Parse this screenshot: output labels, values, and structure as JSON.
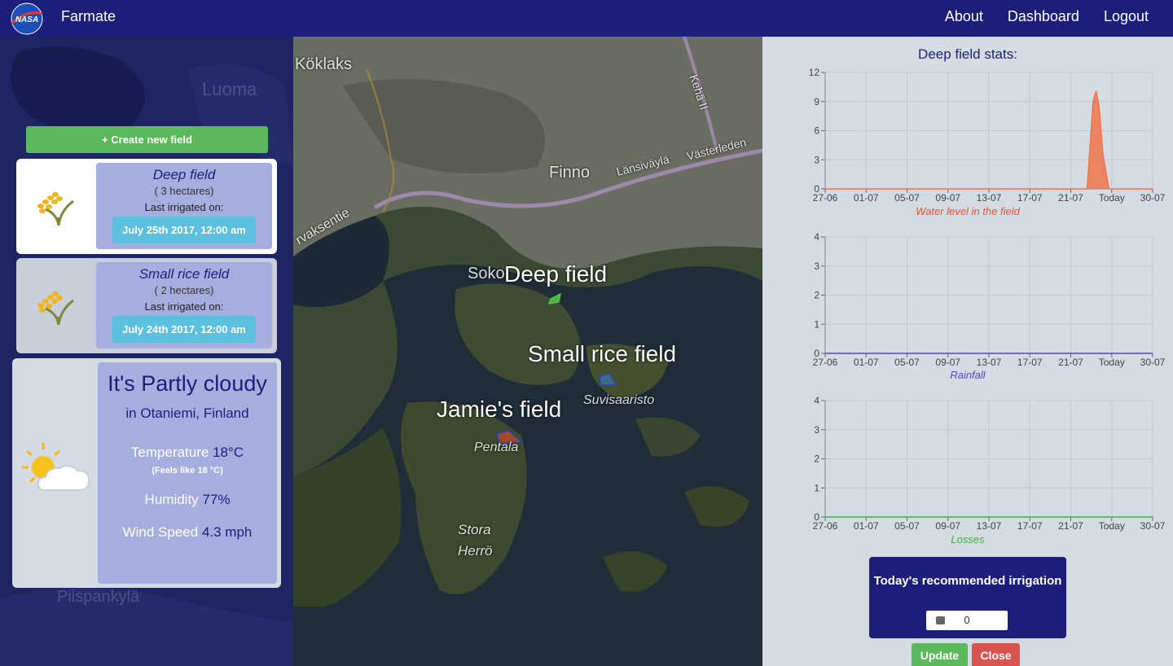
{
  "nav": {
    "logo_text": "NASA",
    "brand": "Farmate",
    "links": [
      "About",
      "Dashboard",
      "Logout"
    ]
  },
  "left": {
    "background_places": [
      "Luoma",
      "Piispankylä"
    ],
    "create_button": "+ Create new field",
    "fields": [
      {
        "name": "Deep field",
        "size": "( 3 hectares)",
        "last_label": "Last irrigated on:",
        "date": "July 25th 2017, 12:00 am",
        "icon": "rice-plant-icon"
      },
      {
        "name": "Small rice field",
        "size": "( 2 hectares)",
        "last_label": "Last irrigated on:",
        "date": "July 24th 2017, 12:00 am",
        "icon": "rice-plant-icon"
      }
    ],
    "weather": {
      "icon": "partly-cloudy-icon",
      "title": "It's Partly cloudy",
      "location": "in Otaniemi, Finland",
      "temp_label": "Temperature",
      "temp_value": "18°C",
      "feels": "(Feels like 18 °C)",
      "humidity_label": "Humidity",
      "humidity_value": "77%",
      "wind_label": "Wind Speed",
      "wind_value": "4.3 mph"
    }
  },
  "map": {
    "places": [
      "Köklaks",
      "Kehä II",
      "Finno",
      "Länsiväylä",
      "Västerleden",
      "rvaksentie",
      "Soko",
      "Suvisaaristo",
      "Pentala",
      "Stora",
      "Herrö"
    ],
    "fields": [
      "Deep field",
      "Small rice field",
      "Jamie's field"
    ]
  },
  "stats": {
    "title": "Deep field stats:",
    "colors": {
      "water": "#f0734a",
      "rainfall": "#5b44c6",
      "losses": "#3cb43c",
      "axis": "#333333"
    }
  },
  "chart_data": [
    {
      "type": "area",
      "caption": "Water level in the field",
      "x_ticks": [
        "27-06",
        "01-07",
        "05-07",
        "09-07",
        "13-07",
        "17-07",
        "21-07",
        "Today",
        "30-07"
      ],
      "y_ticks": [
        0,
        3,
        6,
        9,
        12
      ],
      "ylim": [
        0,
        12
      ],
      "x_range": [
        0,
        33
      ],
      "series": [
        {
          "x": [
            0,
            25,
            26.4,
            26.7,
            27.0,
            27.3,
            27.6,
            28.0,
            28.6,
            33
          ],
          "y": [
            0,
            0,
            0,
            4.5,
            9.0,
            10.1,
            8.5,
            3.5,
            0,
            0
          ]
        }
      ]
    },
    {
      "type": "line",
      "caption": "Rainfall",
      "x_ticks": [
        "27-06",
        "01-07",
        "05-07",
        "09-07",
        "13-07",
        "17-07",
        "21-07",
        "Today",
        "30-07"
      ],
      "y_ticks": [
        0,
        1,
        2,
        3,
        4
      ],
      "ylim": [
        0,
        4
      ],
      "x_range": [
        0,
        33
      ],
      "series": [
        {
          "x": [
            0,
            33
          ],
          "y": [
            0,
            0
          ]
        }
      ]
    },
    {
      "type": "line",
      "caption": "Losses",
      "x_ticks": [
        "27-06",
        "01-07",
        "05-07",
        "09-07",
        "13-07",
        "17-07",
        "21-07",
        "Today",
        "30-07"
      ],
      "y_ticks": [
        0,
        1,
        2,
        3,
        4
      ],
      "ylim": [
        0,
        4
      ],
      "x_range": [
        0,
        33
      ],
      "series": [
        {
          "x": [
            0,
            33
          ],
          "y": [
            0,
            0
          ]
        }
      ]
    }
  ],
  "recommend": {
    "title": "Today's recommended irrigation",
    "value": "0"
  },
  "buttons": {
    "update": "Update",
    "close": "Close"
  }
}
